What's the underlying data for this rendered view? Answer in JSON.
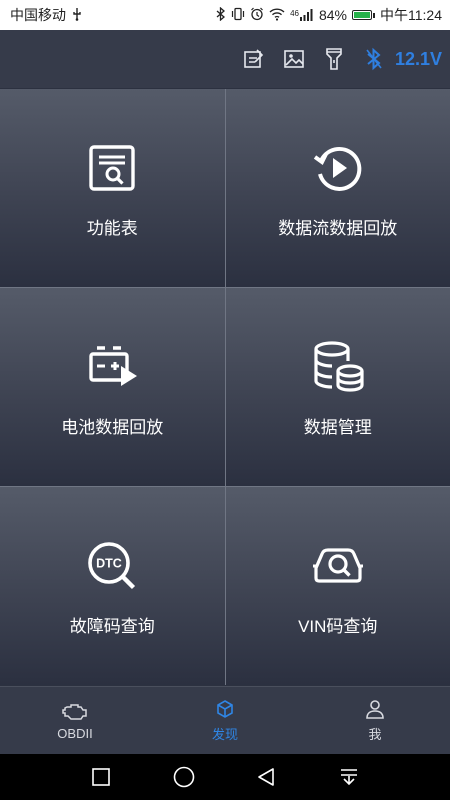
{
  "status": {
    "carrier": "中国移动",
    "signal_text": "46",
    "battery": "84%",
    "time": "中午11:24"
  },
  "toolbar": {
    "voltage": "12.1V",
    "icons": [
      "edit-icon",
      "image-icon",
      "flashlight-icon",
      "bluetooth-icon"
    ]
  },
  "tiles": [
    {
      "label": "功能表",
      "icon": "function-list-icon"
    },
    {
      "label": "数据流数据回放",
      "icon": "replay-icon"
    },
    {
      "label": "电池数据回放",
      "icon": "battery-replay-icon"
    },
    {
      "label": "数据管理",
      "icon": "database-icon"
    },
    {
      "label": "故障码查询",
      "icon": "dtc-search-icon",
      "icon_text": "DTC"
    },
    {
      "label": "VIN码查询",
      "icon": "car-search-icon"
    }
  ],
  "nav": [
    {
      "label": "OBDII",
      "active": false
    },
    {
      "label": "发现",
      "active": true
    },
    {
      "label": "我",
      "active": false
    }
  ],
  "colors": {
    "accent": "#2f86e6",
    "background": "#2c3140",
    "voltage": "#2f7fe0"
  }
}
